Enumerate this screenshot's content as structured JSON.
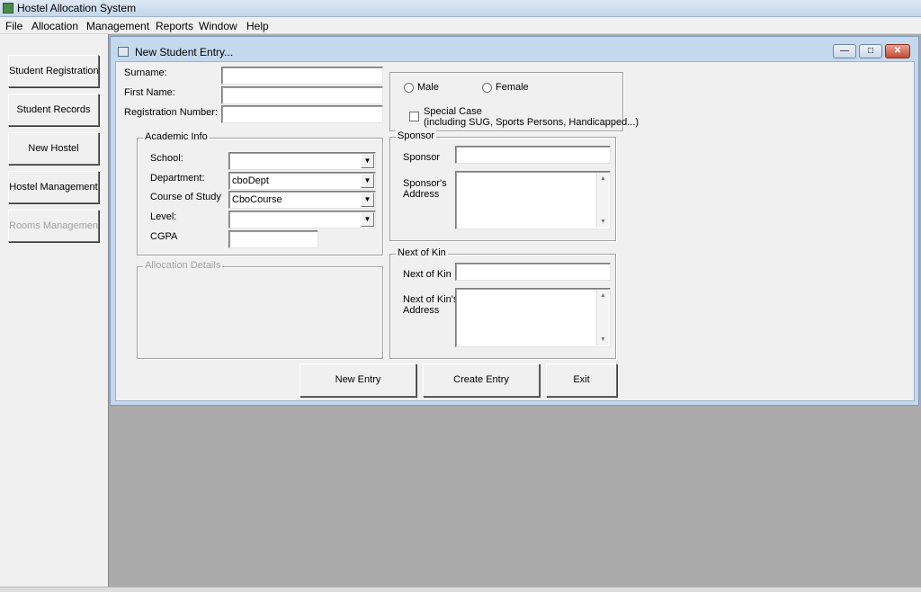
{
  "window": {
    "title": "Hostel Allocation System"
  },
  "menu": [
    "File",
    "Allocation",
    "Management",
    "Reports",
    "Window",
    "Help"
  ],
  "sidebar": {
    "items": [
      {
        "label": "Student Registration"
      },
      {
        "label": "Student Records"
      },
      {
        "label": "New Hostel"
      },
      {
        "label": "Hostel Management"
      },
      {
        "label": "Rooms Management"
      }
    ]
  },
  "form": {
    "title": "New Student Entry...",
    "surname_label": "Surname:",
    "surname_value": "",
    "firstname_label": "First Name:",
    "firstname_value": "",
    "regno_label": "Registration Number:",
    "regno_value": "",
    "gender": {
      "male_label": "Male",
      "female_label": "Female"
    },
    "special_case": {
      "label_line1": "Special Case",
      "label_line2": "(including SUG, Sports Persons, Handicapped...)"
    },
    "academic": {
      "title": "Academic Info",
      "school_label": "School:",
      "school_value": "",
      "department_label": "Department:",
      "department_value": "cboDept",
      "course_label": "Course of Study",
      "course_value": "CboCourse",
      "level_label": "Level:",
      "level_value": "",
      "cgpa_label": "CGPA",
      "cgpa_value": ""
    },
    "allocation": {
      "title": "Allocation Details"
    },
    "sponsor": {
      "title": "Sponsor",
      "sponsor_label": "Sponsor",
      "sponsor_value": "",
      "address_label_line1": "Sponsor's",
      "address_label_line2": "Address"
    },
    "next_of_kin": {
      "title": "Next of Kin",
      "name_label": "Next of Kin",
      "name_value": "",
      "address_label_line1": "Next of Kin's",
      "address_label_line2": "Address"
    },
    "buttons": {
      "new_entry": "New Entry",
      "create_entry": "Create Entry",
      "exit": "Exit"
    }
  },
  "icons": {
    "app": "app-icon",
    "form": "form-icon",
    "combo": "chevron-down-icon"
  }
}
